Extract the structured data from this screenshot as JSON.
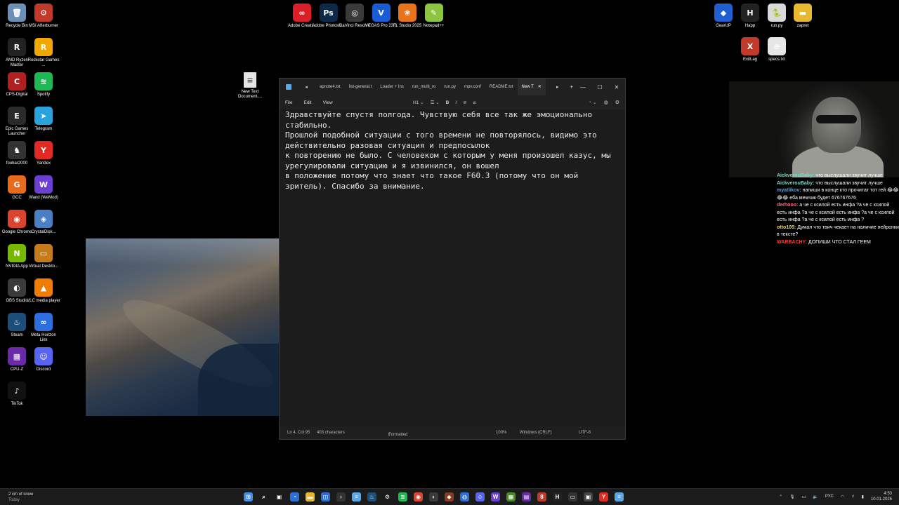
{
  "desktop": {
    "icons_left": [
      {
        "label": "Recycle Bin",
        "icon": "recycle-bin-icon",
        "color": "#6c8fb8",
        "glyph": "🗑"
      },
      {
        "label": "MSI Afterburner",
        "icon": "msi-afterburner-icon",
        "color": "#c0392b",
        "glyph": "⚙"
      },
      {
        "label": "AMD Ryzen Master",
        "icon": "amd-ryzen-icon",
        "color": "#222222",
        "glyph": "R"
      },
      {
        "label": "Rockstar Games ...",
        "icon": "rockstar-icon",
        "color": "#f0a800",
        "glyph": "R"
      },
      {
        "label": "CPS-Digital",
        "icon": "cps-digital-icon",
        "color": "#b02020",
        "glyph": "C"
      },
      {
        "label": "Spotify",
        "icon": "spotify-icon",
        "color": "#1db954",
        "glyph": "≋"
      },
      {
        "label": "Epic Games Launcher",
        "icon": "epic-games-icon",
        "color": "#2a2a2a",
        "glyph": "E"
      },
      {
        "label": "Telegram",
        "icon": "telegram-icon",
        "color": "#2aa3dd",
        "glyph": "➤"
      },
      {
        "label": "foobar2000",
        "icon": "foobar-icon",
        "color": "#333333",
        "glyph": "♞"
      },
      {
        "label": "Yandex",
        "icon": "yandex-icon",
        "color": "#e22a22",
        "glyph": "Y"
      },
      {
        "label": "GCC",
        "icon": "gcc-icon",
        "color": "#e86a1c",
        "glyph": "G"
      },
      {
        "label": "Wand (WeMod)",
        "icon": "wand-icon",
        "color": "#6b3fd4",
        "glyph": "W"
      },
      {
        "label": "Google Chrome",
        "icon": "chrome-icon",
        "color": "#d9432f",
        "glyph": "◉"
      },
      {
        "label": "CrystalDisk...",
        "icon": "crystaldisk-icon",
        "color": "#4a7fc4",
        "glyph": "◈"
      },
      {
        "label": "NVIDIA App",
        "icon": "nvidia-icon",
        "color": "#76b900",
        "glyph": "N"
      },
      {
        "label": "Virtual Deskto...",
        "icon": "virtual-desktop-icon",
        "color": "#c77a1a",
        "glyph": "▭"
      },
      {
        "label": "OBS Studio",
        "icon": "obs-icon",
        "color": "#3a3a3a",
        "glyph": "◐"
      },
      {
        "label": "VLC media player",
        "icon": "vlc-icon",
        "color": "#f07d00",
        "glyph": "▲"
      },
      {
        "label": "Steam",
        "icon": "steam-icon",
        "color": "#1b4e7a",
        "glyph": "♨"
      },
      {
        "label": "Meta Horizon Link",
        "icon": "meta-icon",
        "color": "#2d6ee0",
        "glyph": "∞"
      },
      {
        "label": "CPU-Z",
        "icon": "cpuz-icon",
        "color": "#6a2aa8",
        "glyph": "▦"
      },
      {
        "label": "Discord",
        "icon": "discord-icon",
        "color": "#5865f2",
        "glyph": "☺"
      },
      {
        "label": "TikTok",
        "icon": "tiktok-icon",
        "color": "#111111",
        "glyph": "♪"
      }
    ],
    "icons_top": [
      {
        "label": "Adobe Creati...",
        "icon": "adobe-cc-icon",
        "color": "#da1f26",
        "glyph": "∞"
      },
      {
        "label": "Adobe Photosh...",
        "icon": "photoshop-icon",
        "color": "#0b2a4a",
        "glyph": "Ps"
      },
      {
        "label": "DaVinci Resolve",
        "icon": "davinci-icon",
        "color": "#3a3a3a",
        "glyph": "◎"
      },
      {
        "label": "VEGAS Pro 23.0",
        "icon": "vegas-icon",
        "color": "#1a5bd6",
        "glyph": "V"
      },
      {
        "label": "FL Studio 2025",
        "icon": "fl-studio-icon",
        "color": "#e8731a",
        "glyph": "❀"
      },
      {
        "label": "Notepad++",
        "icon": "notepadpp-icon",
        "color": "#8cc63f",
        "glyph": "✎"
      }
    ],
    "icons_right": [
      {
        "label": "GearUP",
        "icon": "gearup-icon",
        "color": "#1f5fd1",
        "glyph": "◆"
      },
      {
        "label": "Happ",
        "icon": "happ-icon",
        "color": "#222222",
        "glyph": "H"
      },
      {
        "label": "run.py",
        "icon": "python-file-icon",
        "color": "#d9d9d9",
        "glyph": "🐍"
      },
      {
        "label": "zapret",
        "icon": "folder-icon",
        "color": "#e8b92e",
        "glyph": "▬"
      },
      {
        "label": "ExitLag",
        "icon": "exitlag-icon",
        "color": "#c0392b",
        "glyph": "X"
      },
      {
        "label": "specs.txt",
        "icon": "text-file-icon",
        "color": "#e6e6e6",
        "glyph": "≡"
      }
    ],
    "new_text_doc": {
      "label": "New Text Document....",
      "icon": "text-file-icon"
    }
  },
  "notepad": {
    "tabs": [
      "apnote4.txt",
      "list-general.t",
      "Loader + Ins",
      "run_multi_ro",
      "run.py",
      "mpv.conf",
      "README.txt",
      "New T"
    ],
    "menu": [
      "File",
      "Edit",
      "View"
    ],
    "heading_selector": "H1",
    "content": "Здравствуйте спустя полгода. Чувствую себя все так же эмоционально стабильно.\nПрошлой подобной ситуации с того времени не повторялось, видимо это действительно разовая ситуация и предпосылок\nк повторению не было. С человеком с которым у меня произошел казус, мы урегулировали ситуацию и я извинился, он вошел\nв положение потому что знает что такое F60.3 (потому что он мой зритель). Спасибо за внимание.",
    "status": {
      "position": "Ln 4, Col 95",
      "characters": "403 characters",
      "format": "Formatted",
      "zoom": "100%",
      "line_endings": "Windows (CRLF)",
      "encoding": "UTF-8"
    }
  },
  "chat": {
    "messages": [
      {
        "user": "AickverouBaby:",
        "text": "что выслушали звучит лучше",
        "color": "#6fe0c0"
      },
      {
        "user": "AickverouBaby:",
        "text": "что выслушали звучит лучше",
        "color": "#6fe0c0"
      },
      {
        "user": "myatlikov:",
        "text": "напиши в конце кто прочитат тот гей 😂😂😂😂 еба мемчик будет 676767676",
        "color": "#4aa8ff"
      },
      {
        "user": "derhooo:",
        "text": "а че с ксилой есть инфа ?а че с ксилой есть инфа ?а че с ксилой есть инфа ?а че с ксилой есть инфа ?а че с ксилой есть инфа ?",
        "color": "#ff6b8a"
      },
      {
        "user": "otto105:",
        "text": "Думал что твич чекает на наличие нейронки в тексте?",
        "color": "#f5d76e"
      },
      {
        "user": "WARBACHY:",
        "text": "ДОПИШИ ЧТО СТАЛ ГЕЕМ",
        "color": "#ff3b3b"
      }
    ]
  },
  "taskbar": {
    "weather_line1": "2 cm of snow",
    "weather_line2": "Today",
    "language": "РУС",
    "time": "4:53",
    "date": "10.01.2026",
    "pinned": [
      {
        "icon": "windows-start-icon",
        "color": "#3d8ee8",
        "glyph": "⊞"
      },
      {
        "icon": "search-icon",
        "color": "#1b1b1b",
        "glyph": "⌕"
      },
      {
        "icon": "task-view-icon",
        "color": "#1b1b1b",
        "glyph": "▣"
      },
      {
        "icon": "copilot-icon",
        "color": "#2c6fd6",
        "glyph": "◔"
      },
      {
        "icon": "explorer-icon",
        "color": "#e8b92e",
        "glyph": "▬"
      },
      {
        "icon": "store-icon",
        "color": "#2c6fd6",
        "glyph": "◫"
      },
      {
        "icon": "terminal-icon",
        "color": "#333333",
        "glyph": "›"
      },
      {
        "icon": "notepad-icon",
        "color": "#5aa9e6",
        "glyph": "≡"
      },
      {
        "icon": "steam-icon",
        "color": "#1b4e7a",
        "glyph": "♨"
      },
      {
        "icon": "settings-icon",
        "color": "#1b1b1b",
        "glyph": "⚙"
      },
      {
        "icon": "spotify-icon",
        "color": "#1db954",
        "glyph": "≋"
      },
      {
        "icon": "chrome-icon",
        "color": "#d9432f",
        "glyph": "◉"
      },
      {
        "icon": "obs-icon",
        "color": "#3a3a3a",
        "glyph": "◐"
      },
      {
        "icon": "app-icon",
        "color": "#8a3a22",
        "glyph": "◆"
      },
      {
        "icon": "globe-icon",
        "color": "#2c6fd6",
        "glyph": "◍"
      },
      {
        "icon": "discord-icon",
        "color": "#5865f2",
        "glyph": "☺"
      },
      {
        "icon": "wand-icon",
        "color": "#6b3fd4",
        "glyph": "W"
      },
      {
        "icon": "minecraft-icon",
        "color": "#4c8a2a",
        "glyph": "▦"
      },
      {
        "icon": "cpuz-icon",
        "color": "#6a2aa8",
        "glyph": "▤"
      },
      {
        "icon": "app-red-icon",
        "color": "#c0392b",
        "glyph": "8"
      },
      {
        "icon": "happ-icon",
        "color": "#222222",
        "glyph": "H"
      },
      {
        "icon": "terminal-icon",
        "color": "#333333",
        "glyph": "▭"
      },
      {
        "icon": "app-gray-icon",
        "color": "#444444",
        "glyph": "▣"
      },
      {
        "icon": "yandex-icon",
        "color": "#e22a22",
        "glyph": "Y"
      },
      {
        "icon": "notepad-icon",
        "color": "#5aa9e6",
        "glyph": "≡"
      }
    ]
  }
}
